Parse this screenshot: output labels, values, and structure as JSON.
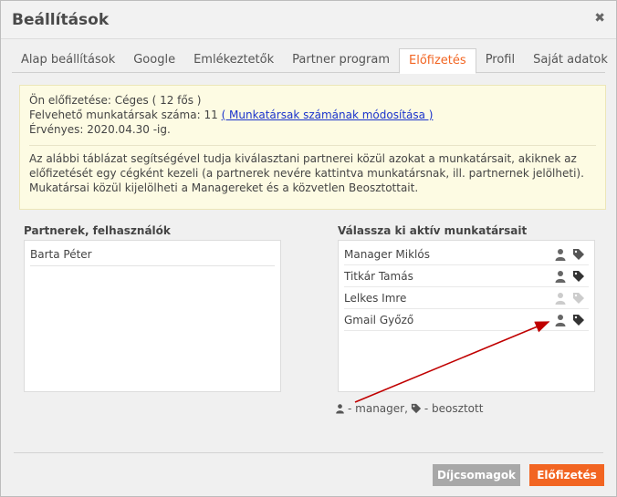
{
  "dialog": {
    "title": "Beállítások",
    "close_icon": "close-icon"
  },
  "tabs": [
    {
      "label": "Alap beállítások",
      "active": false
    },
    {
      "label": "Google",
      "active": false
    },
    {
      "label": "Emlékeztetők",
      "active": false
    },
    {
      "label": "Partner program",
      "active": false
    },
    {
      "label": "Előfizetés",
      "active": true
    },
    {
      "label": "Profil",
      "active": false
    },
    {
      "label": "Saját adatok",
      "active": false
    }
  ],
  "info": {
    "line1": "Ön előfizetése: Céges ( 12 fős )",
    "line2_prefix": "Felvehető munkatársak száma: 11",
    "line2_link": "( Munkatársak számának módosítása )",
    "line3": "Érvényes: 2020.04.30 -ig.",
    "para1": "Az alábbi táblázat segítségével tudja kiválasztani partnerei közül azokat a munkatársait, akiknek az előfizetését egy cégként kezeli (a partnerek nevére kattintva munkatársnak, ill. partnernek jelölheti).",
    "para2": "Mukatársai közül kijelölheti a Managereket és a közvetlen Beosztottait."
  },
  "partners": {
    "title": "Partnerek, felhasználók",
    "items": [
      "Barta Péter"
    ]
  },
  "staff": {
    "title": "Válassza ki aktív munkatársait",
    "items": [
      {
        "name": "Manager Miklós",
        "active": true
      },
      {
        "name": "Titkár Tamás",
        "active": true
      },
      {
        "name": "Lelkes Imre",
        "active": false
      },
      {
        "name": "Gmail Győző",
        "active": true
      }
    ]
  },
  "legend": {
    "manager_text": "- manager,",
    "subordinate_text": "- beosztott"
  },
  "buttons": {
    "packages": "Díjcsomagok",
    "subscribe": "Előfizetés"
  },
  "colors": {
    "accent": "#f26522",
    "info_bg": "#fdfbe3",
    "link": "#1a33cc",
    "arrow": "#c00000",
    "icon_active": "#666666",
    "icon_inactive": "#cccccc"
  }
}
